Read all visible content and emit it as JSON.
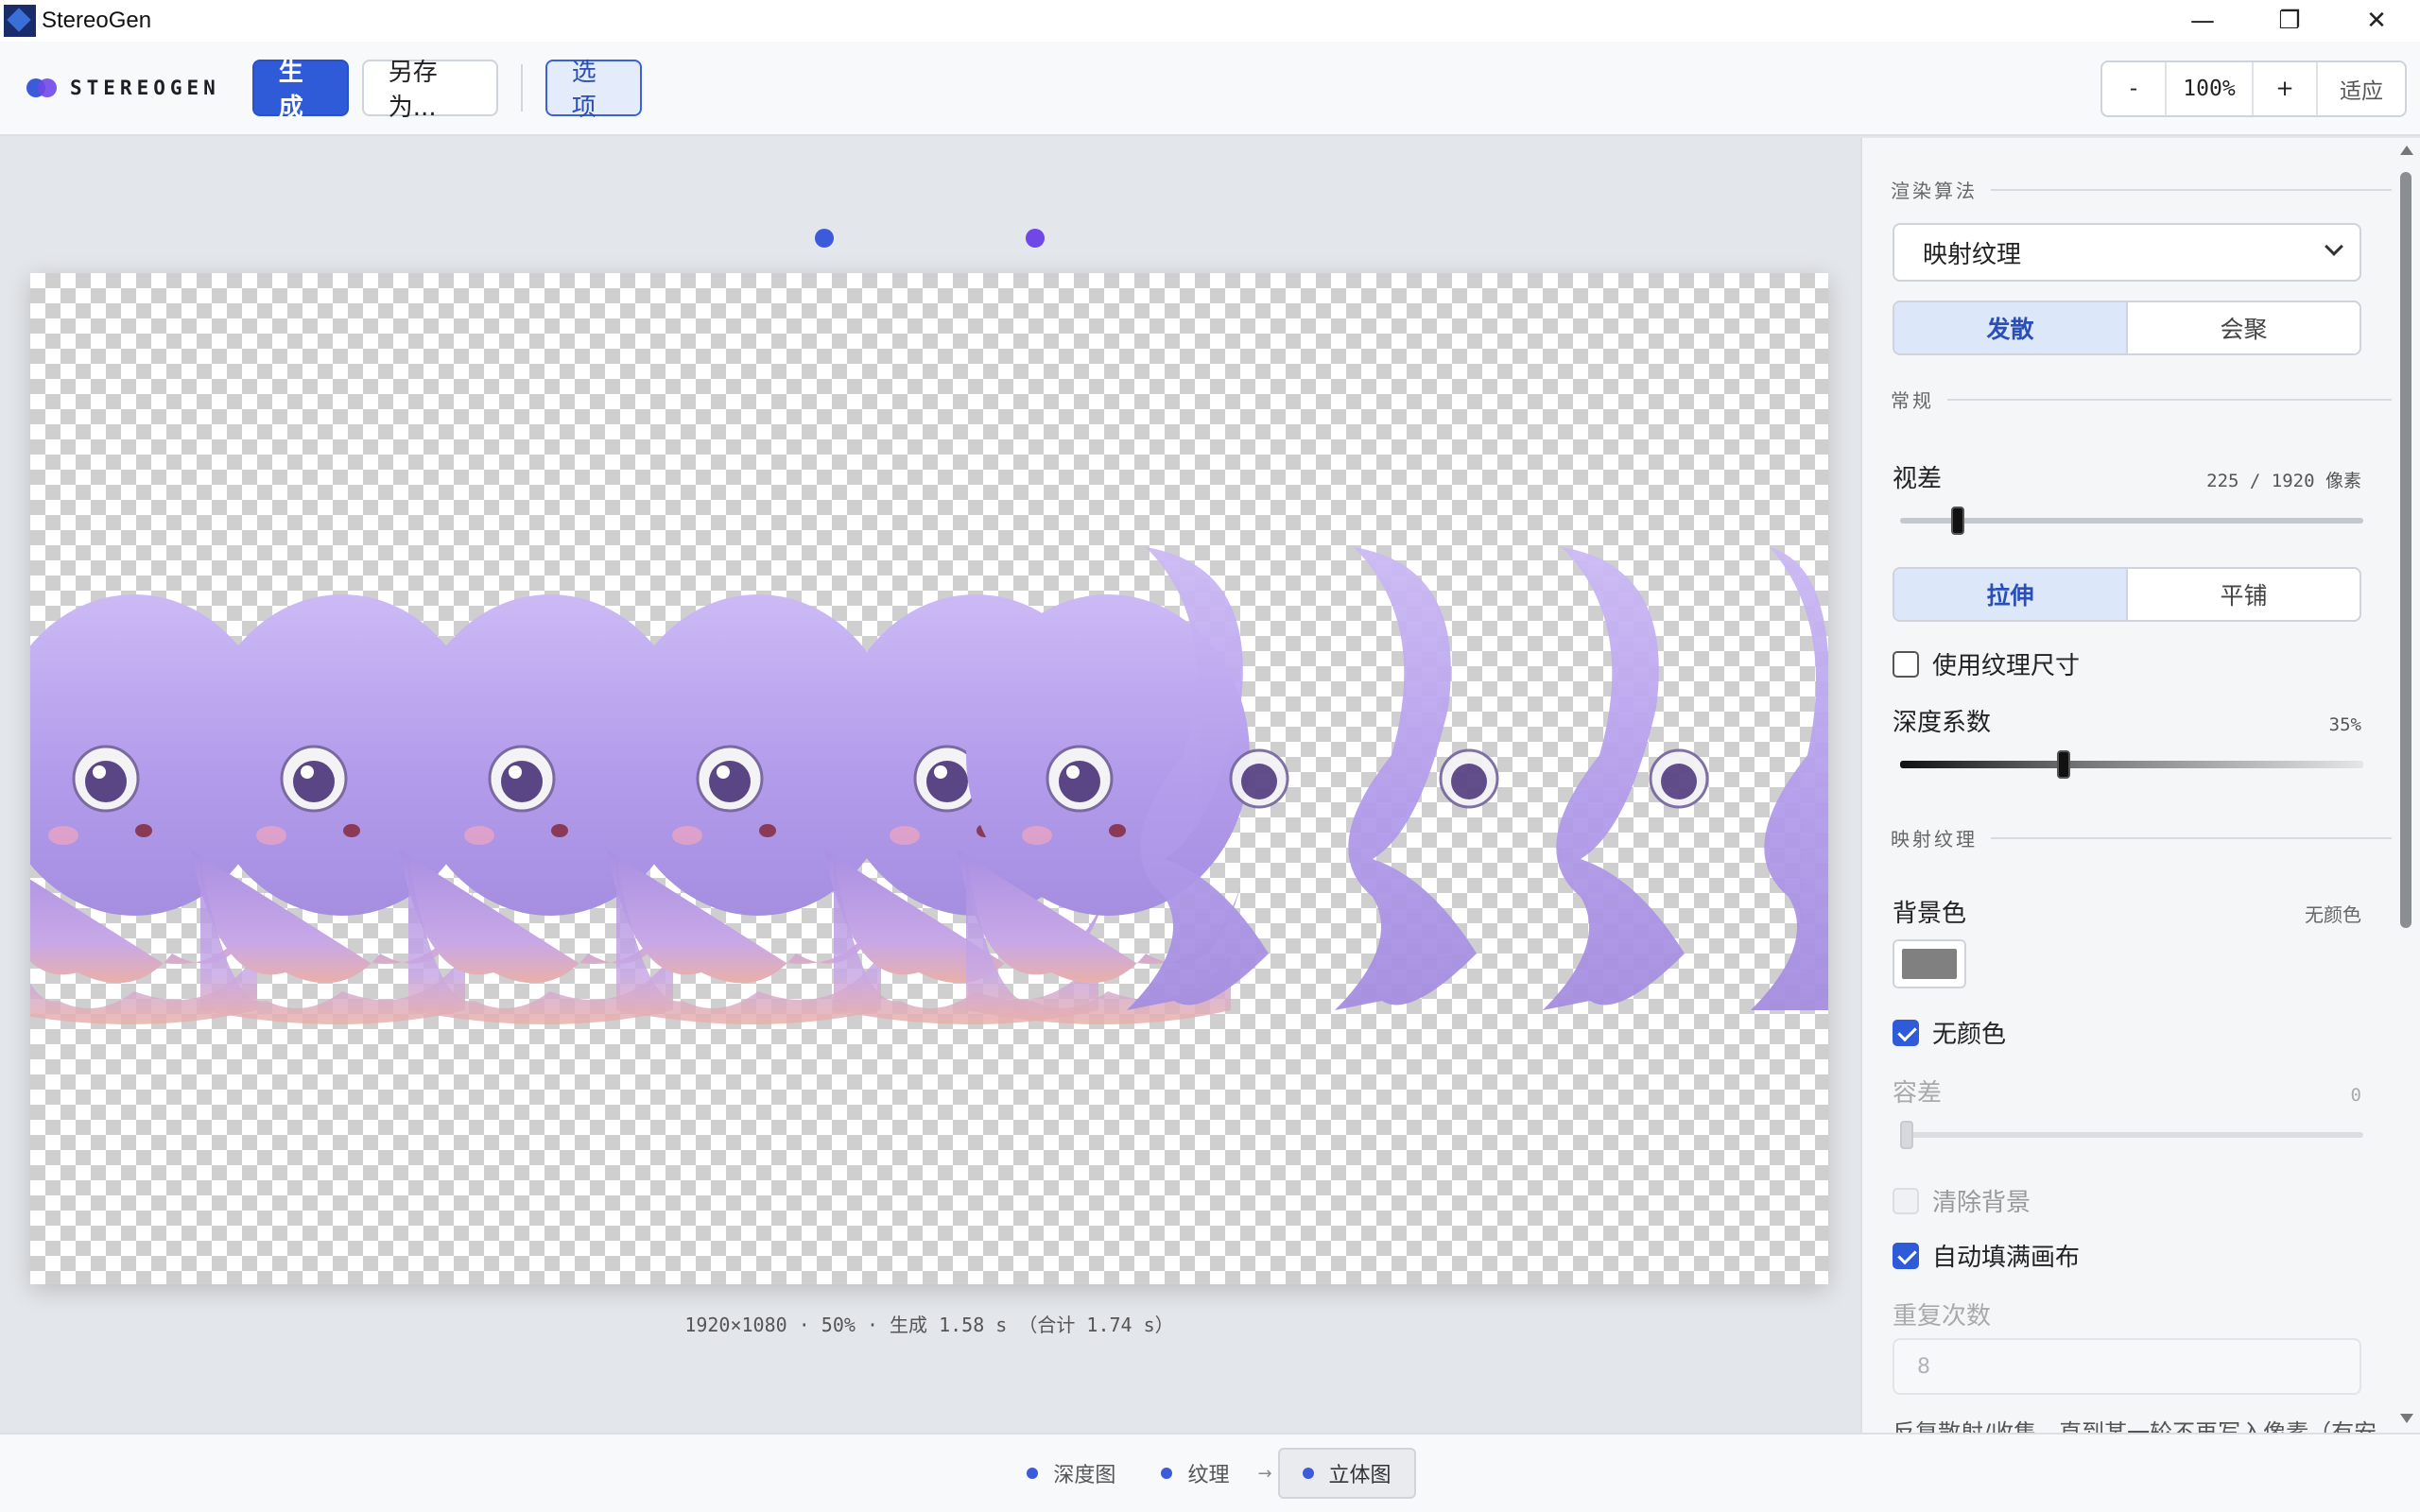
{
  "window": {
    "title": "StereoGen",
    "controls": {
      "minimize": "—",
      "maximize": "❐",
      "close": "✕"
    }
  },
  "toolbar": {
    "logo_text": "STEREOGEN",
    "generate_label": "生成",
    "save_as_label": "另存为...",
    "options_label": "选项",
    "zoom": {
      "minus": "-",
      "value": "100%",
      "plus": "+",
      "fit": "适应"
    }
  },
  "canvas": {
    "status": "1920×1080 · 50% · 生成 1.58 s （合计 1.74 s）"
  },
  "sidebar": {
    "section_render": "渲染算法",
    "algorithm_selected": "映射纹理",
    "eye_mode": {
      "options": [
        "发散",
        "会聚"
      ],
      "selected": 0
    },
    "section_general": "常规",
    "parallax": {
      "label": "视差",
      "value_text": "225 / 1920 像素",
      "value": 225,
      "max": 1920
    },
    "fill_mode": {
      "options": [
        "拉伸",
        "平铺"
      ],
      "selected": 0
    },
    "use_texture_size": {
      "label": "使用纹理尺寸",
      "checked": false
    },
    "depth": {
      "label": "深度系数",
      "value_text": "35%",
      "value": 35
    },
    "section_map": "映射纹理",
    "background": {
      "label": "背景色",
      "value_text": "无颜色",
      "swatch_color": "#808080"
    },
    "no_color": {
      "label": "无颜色",
      "checked": true
    },
    "tolerance": {
      "label": "容差",
      "value_text": "0",
      "value": 0
    },
    "clear_background": {
      "label": "清除背景",
      "checked": false
    },
    "auto_fill": {
      "label": "自动填满画布",
      "checked": true
    },
    "repeat": {
      "label": "重复次数",
      "value": "8"
    },
    "help_text": "反复散射/收集，直到某一轮不再写入像素（有安"
  },
  "steps": {
    "depth_map": "深度图",
    "texture": "纹理",
    "arrow": "→",
    "stereogram": "立体图"
  },
  "colors": {
    "accent": "#2f5ad8",
    "dot_left": "#3b5bdb",
    "dot_right": "#7048e8",
    "octopus": "#b9a3ee"
  }
}
